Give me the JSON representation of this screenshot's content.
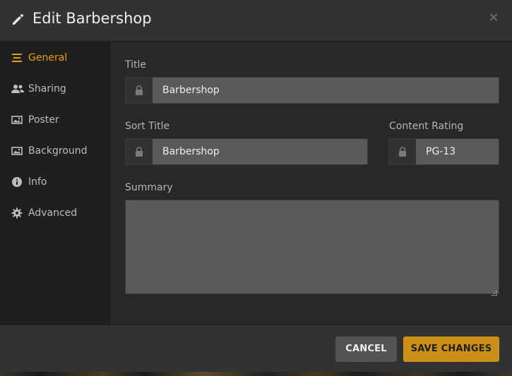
{
  "header": {
    "title": "Edit Barbershop",
    "close_symbol": "×",
    "pencil_icon": "pencil-icon",
    "close_icon": "close-icon"
  },
  "sidebar": {
    "items": [
      {
        "label": "General",
        "icon": "general-icon",
        "active": true
      },
      {
        "label": "Sharing",
        "icon": "people-icon",
        "active": false
      },
      {
        "label": "Poster",
        "icon": "image-icon",
        "active": false
      },
      {
        "label": "Background",
        "icon": "image-icon",
        "active": false
      },
      {
        "label": "Info",
        "icon": "info-icon",
        "active": false
      },
      {
        "label": "Advanced",
        "icon": "gear-icon",
        "active": false
      }
    ]
  },
  "form": {
    "title_label": "Title",
    "title_value": "Barbershop",
    "sort_title_label": "Sort Title",
    "sort_title_value": "Barbershop",
    "content_rating_label": "Content Rating",
    "content_rating_value": "PG-13",
    "summary_label": "Summary",
    "summary_value": ""
  },
  "footer": {
    "cancel_label": "CANCEL",
    "save_label": "SAVE CHANGES"
  },
  "colors": {
    "accent": "#e5a00d",
    "save_button": "#cc8f17",
    "cancel_button": "#545454",
    "field_bg": "#5a5a5a"
  }
}
